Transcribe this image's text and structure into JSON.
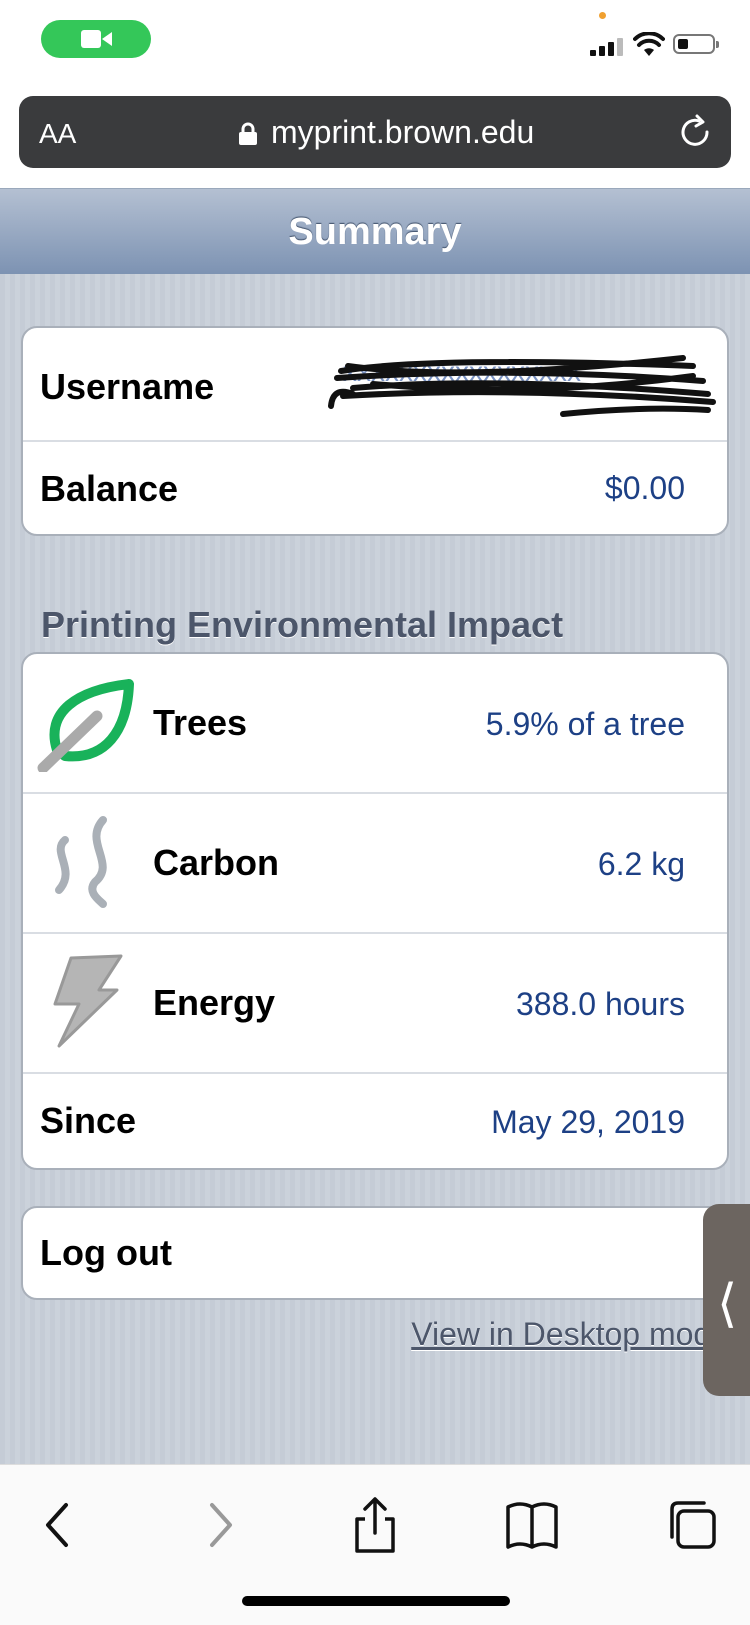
{
  "browser": {
    "text_size_label": "AA",
    "url": "myprint.brown.edu"
  },
  "header": {
    "title": "Summary"
  },
  "account": {
    "username_label": "Username",
    "balance_label": "Balance",
    "balance_value": "$0.00"
  },
  "impact": {
    "section_title": "Printing Environmental Impact",
    "rows": [
      {
        "label": "Trees",
        "value": "5.9% of a tree",
        "icon": "leaf-icon"
      },
      {
        "label": "Carbon",
        "value": "6.2 kg",
        "icon": "steam-icon"
      },
      {
        "label": "Energy",
        "value": "388.0 hours",
        "icon": "lightning-icon"
      }
    ],
    "since_label": "Since",
    "since_value": "May 29, 2019"
  },
  "actions": {
    "logout_label": "Log out"
  },
  "footer": {
    "desktop_link": "View in Desktop mode"
  },
  "colors": {
    "value_text": "#1d4085",
    "accent_green": "#34c759",
    "leaf_green": "#19b25a"
  }
}
